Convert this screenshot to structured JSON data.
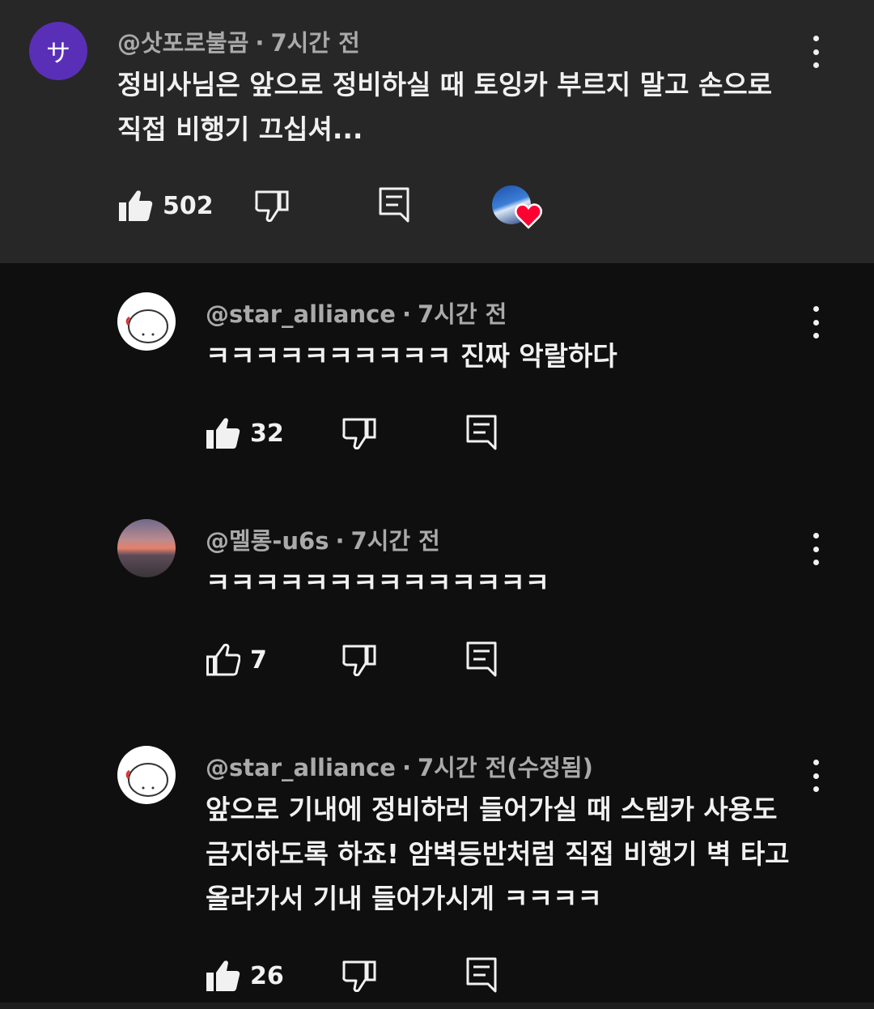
{
  "comments": [
    {
      "avatar_letter": "サ",
      "author": "@삿포로불곰",
      "time": "7시간 전",
      "text_lines": [
        "정비사님은 앞으로 정비하실 때 토잉카 부르지 말고 손으로",
        "직접 비행기 끄십셔..."
      ],
      "likes": "502",
      "liked": true,
      "creator_heart": true
    },
    {
      "author": "@star_alliance",
      "time": "7시간 전",
      "text_lines": [
        "ㅋㅋㅋㅋㅋㅋㅋㅋㅋㅋ 진짜 악랄하다"
      ],
      "likes": "32",
      "liked": true
    },
    {
      "author": "@멜롱-u6s",
      "time": "7시간 전",
      "text_lines": [
        "ㅋㅋㅋㅋㅋㅋㅋㅋㅋㅋㅋㅋㅋㅋ"
      ],
      "likes": "7",
      "liked": false
    },
    {
      "author": "@star_alliance",
      "time": "7시간 전(수정됨)",
      "text_lines": [
        "앞으로 기내에 정비하러 들어가실 때 스텝카 사용도",
        "금지하도록 하죠! 암벽등반처럼 직접 비행기 벽 타고",
        "올라가서 기내 들어가시게 ㅋㅋㅋㅋ"
      ],
      "likes": "26",
      "liked": true
    }
  ],
  "icons": {
    "like": "thumbs-up-icon",
    "dislike": "thumbs-down-icon",
    "reply": "reply-icon",
    "more": "more-vert-icon",
    "heart": "heart-icon"
  },
  "colors": {
    "background": "#0f0f0f",
    "highlighted_comment_bg": "#272727",
    "text": "#f1f1f1",
    "meta_text": "#aaaaaa",
    "avatar_purple": "#5a2fb8",
    "heart_red": "#ff0033"
  }
}
